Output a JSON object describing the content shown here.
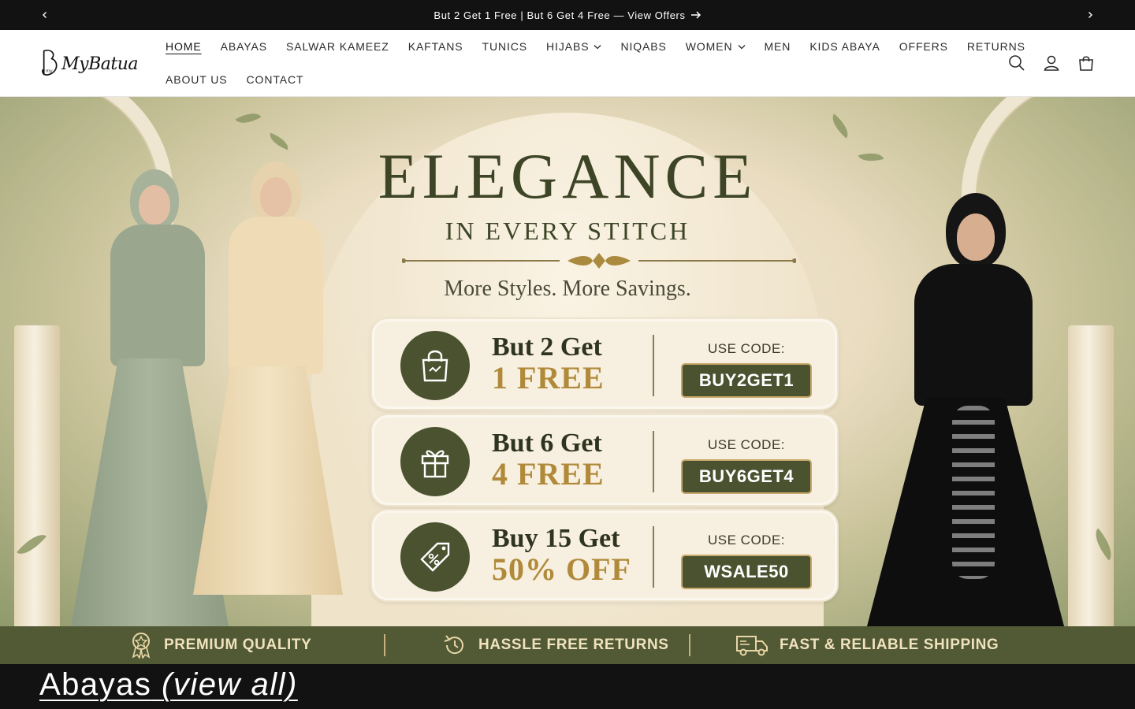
{
  "announcement": {
    "message": "But 2 Get 1 Free | But 6 Get 4 Free — View Offers"
  },
  "brand": {
    "name": "MyBatua",
    "mark": "B"
  },
  "nav": {
    "row1": [
      {
        "label": "HOME",
        "active": true
      },
      {
        "label": "ABAYAS"
      },
      {
        "label": "SALWAR KAMEEZ"
      },
      {
        "label": "KAFTANS"
      },
      {
        "label": "TUNICS"
      },
      {
        "label": "HIJABS",
        "dropdown": true
      },
      {
        "label": "NIQABS"
      },
      {
        "label": "WOMEN",
        "dropdown": true
      },
      {
        "label": "MEN"
      },
      {
        "label": "KIDS ABAYA"
      },
      {
        "label": "OFFERS"
      },
      {
        "label": "RETURNS"
      }
    ],
    "row2": [
      {
        "label": "ABOUT US"
      },
      {
        "label": "CONTACT"
      }
    ]
  },
  "hero": {
    "title": "ELEGANCE",
    "subtitle": "IN EVERY STITCH",
    "tagline": "More Styles. More Savings.",
    "offers": [
      {
        "line1": "But 2 Get",
        "line2": "1 FREE",
        "code_label": "USE CODE:",
        "code": "BUY2GET1",
        "icon": "shopping-bag-icon"
      },
      {
        "line1": "But 6 Get",
        "line2": "4 FREE",
        "code_label": "USE CODE:",
        "code": "BUY6GET4",
        "icon": "gift-icon"
      },
      {
        "line1": "Buy 15 Get",
        "line2": "50% OFF",
        "code_label": "USE CODE:",
        "code": "WSALE50",
        "icon": "discount-tag-icon"
      }
    ]
  },
  "benefits": [
    {
      "label": "PREMIUM QUALITY",
      "icon": "award-badge-icon"
    },
    {
      "label": "HASSLE FREE RETURNS",
      "icon": "return-arrow-icon"
    },
    {
      "label": "FAST & RELIABLE SHIPPING",
      "icon": "delivery-truck-icon"
    }
  ],
  "section": {
    "title": "Abayas",
    "view_all": "(view all)"
  },
  "colors": {
    "olive": "#4a5230",
    "gold": "#b08a3a",
    "cream": "#f7efdf",
    "dark": "#121212"
  }
}
